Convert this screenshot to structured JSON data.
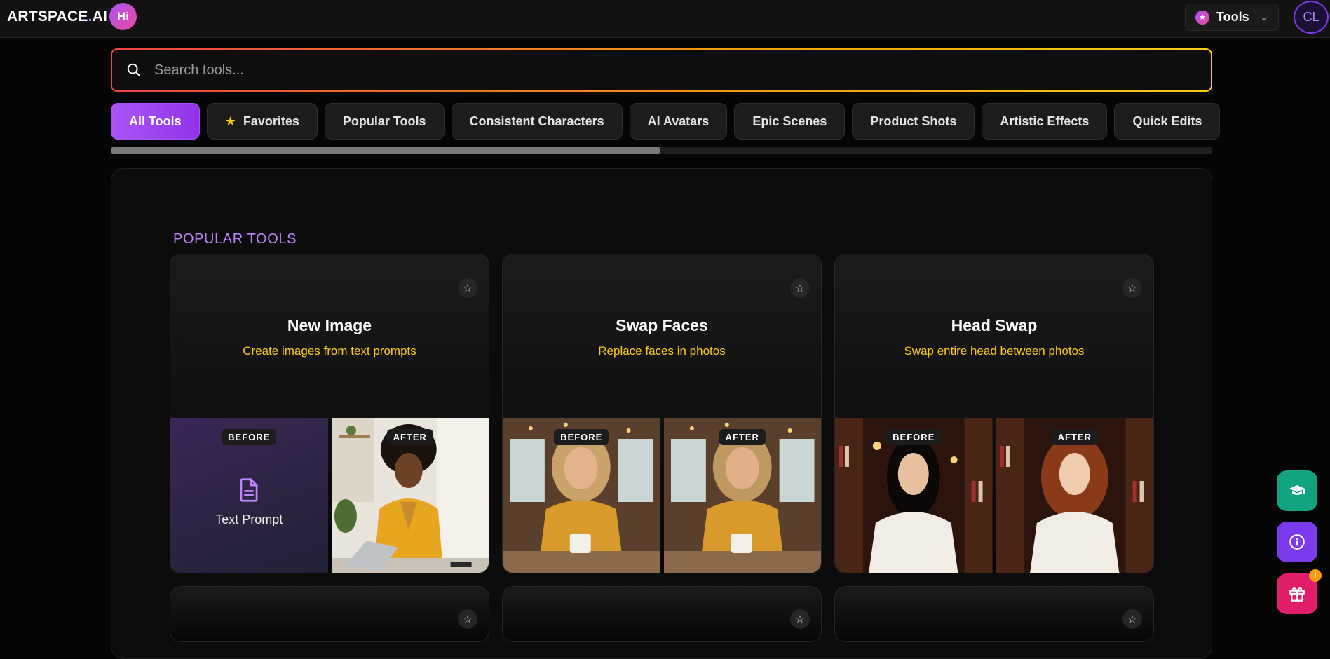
{
  "header": {
    "logo_main": "ARTSPACE",
    "logo_dot": ".",
    "logo_suffix": "AI",
    "badge": "Hi",
    "tools_label": "Tools",
    "avatar_initials": "CL"
  },
  "search": {
    "placeholder": "Search tools...",
    "value": ""
  },
  "categories": [
    {
      "label": "All Tools",
      "active": true
    },
    {
      "label": "Favorites",
      "active": false
    },
    {
      "label": "Popular Tools",
      "active": false
    },
    {
      "label": "Consistent Characters",
      "active": false
    },
    {
      "label": "AI Avatars",
      "active": false
    },
    {
      "label": "Epic Scenes",
      "active": false
    },
    {
      "label": "Product Shots",
      "active": false
    },
    {
      "label": "Artistic Effects",
      "active": false
    },
    {
      "label": "Quick Edits",
      "active": false
    }
  ],
  "section": {
    "title": "POPULAR TOOLS"
  },
  "cards": [
    {
      "title": "New Image",
      "subtitle": "Create images from text prompts",
      "before_label": "BEFORE",
      "after_label": "AFTER",
      "before_text": "Text Prompt"
    },
    {
      "title": "Swap Faces",
      "subtitle": "Replace faces in photos",
      "before_label": "BEFORE",
      "after_label": "AFTER"
    },
    {
      "title": "Head Swap",
      "subtitle": "Swap entire head between photos",
      "before_label": "BEFORE",
      "after_label": "AFTER"
    }
  ],
  "fab": {
    "notification_count": "!"
  },
  "colors": {
    "accent_purple": "#a855f7",
    "subtitle_yellow": "#facc15",
    "section_purple": "#c084fc"
  }
}
